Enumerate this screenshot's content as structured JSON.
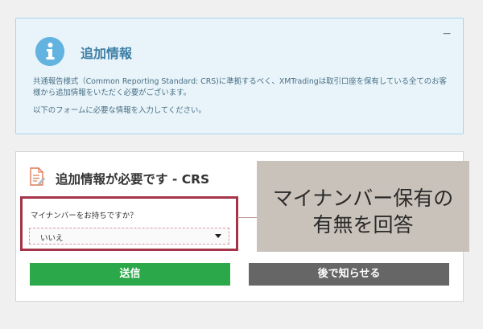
{
  "info_box": {
    "title": "追加情報",
    "minimize": "−",
    "text_1": "共通報告様式（Common Reporting Standard: CRS)に準拠するべく、XMTradingは取引口座を保有している全てのお客様から追加情報をいただく必要がございます。",
    "text_2": "以下のフォームに必要な情報を入力してください。",
    "icon": "info-icon",
    "accent_color": "#63b3e0"
  },
  "crs_panel": {
    "title": "追加情報が必要です - CRS",
    "icon": "document-edit-icon",
    "question": "マイナンバーをお持ちですか？",
    "select_value": "いいえ",
    "buttons": {
      "send": "送信",
      "later": "後で知らせる"
    },
    "colors": {
      "send": "#2aa84a",
      "later": "#666666",
      "highlight": "#a5344b"
    }
  },
  "callout": {
    "line_1": "マイナンバー保有の",
    "line_2": "有無を回答"
  }
}
